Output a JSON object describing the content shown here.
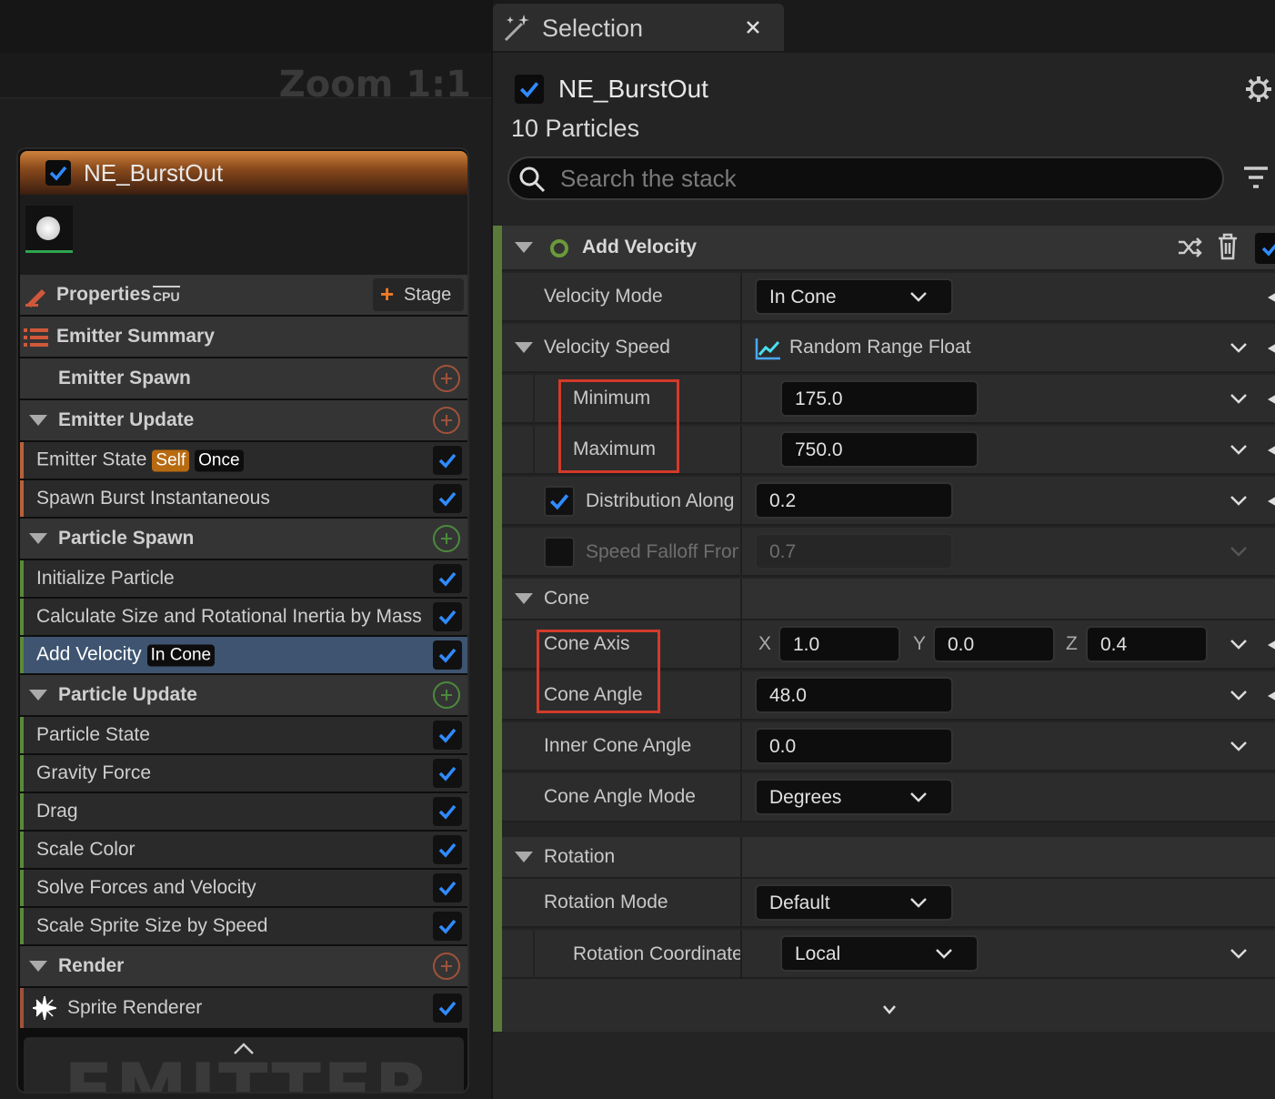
{
  "graph": {
    "zoom": "Zoom 1:1",
    "watermark": "EMITTER"
  },
  "node": {
    "title": "NE_BurstOut",
    "properties": "Properties",
    "cpu": "CPU",
    "stage": "Stage",
    "summary": "Emitter Summary",
    "emitter_spawn": "Emitter Spawn",
    "emitter_update": "Emitter Update",
    "emitter_state": "Emitter State",
    "self": "Self",
    "once": "Once",
    "spawn_burst": "Spawn Burst Instantaneous",
    "particle_spawn": "Particle Spawn",
    "init_particle": "Initialize Particle",
    "calc_size": "Calculate Size and Rotational Inertia by Mass",
    "add_velocity": "Add Velocity",
    "in_cone": "In Cone",
    "particle_update": "Particle Update",
    "particle_state": "Particle State",
    "gravity": "Gravity Force",
    "drag": "Drag",
    "scale_color": "Scale Color",
    "solve_forces": "Solve Forces and Velocity",
    "scale_sprite": "Scale Sprite Size by Speed",
    "render": "Render",
    "sprite_renderer": "Sprite Renderer"
  },
  "panel": {
    "tab": "Selection",
    "emitter": "NE_BurstOut",
    "particles": "10 Particles",
    "search_placeholder": "Search the stack",
    "module": "Add Velocity",
    "velocity_mode": {
      "label": "Velocity Mode",
      "value": "In Cone"
    },
    "velocity_speed": {
      "label": "Velocity Speed",
      "value": "Random Range Float"
    },
    "minimum": {
      "label": "Minimum",
      "value": "175.0"
    },
    "maximum": {
      "label": "Maximum",
      "value": "750.0"
    },
    "distribution": {
      "label": "Distribution Along",
      "value": "0.2"
    },
    "falloff": {
      "label": "Speed Falloff From",
      "value": "0.7"
    },
    "cone": "Cone",
    "cone_axis": {
      "label": "Cone Axis",
      "x_label": "X",
      "x": "1.0",
      "y_label": "Y",
      "y": "0.0",
      "z_label": "Z",
      "z": "0.4"
    },
    "cone_angle": {
      "label": "Cone Angle",
      "value": "48.0"
    },
    "inner_cone": {
      "label": "Inner Cone Angle",
      "value": "0.0"
    },
    "cone_mode": {
      "label": "Cone Angle Mode",
      "value": "Degrees"
    },
    "rotation": "Rotation",
    "rotation_mode": {
      "label": "Rotation Mode",
      "value": "Default"
    },
    "rotation_coord": {
      "label": "Rotation Coordinate",
      "value": "Local"
    }
  }
}
